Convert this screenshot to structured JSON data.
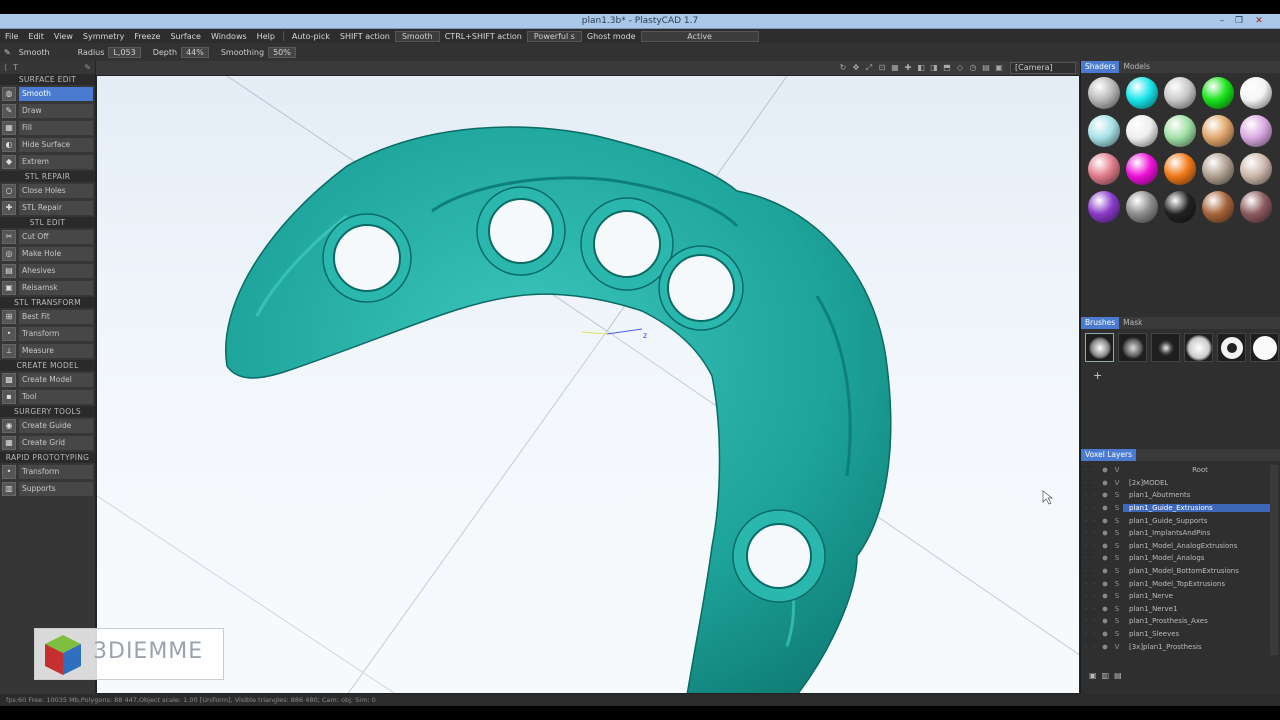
{
  "window": {
    "title": "plan1.3b* - PlastyCAD 1.7",
    "minimize": "–",
    "maximize": "❐",
    "close": "✕"
  },
  "menubar": {
    "items": [
      "File",
      "Edit",
      "View",
      "Symmetry",
      "Freeze",
      "Surface",
      "Windows",
      "Help"
    ],
    "auto_pick": "Auto-pick",
    "shift_action_label": "SHIFT action",
    "shift_action_value": "Smooth",
    "ctrl_shift_label": "CTRL+SHIFT action",
    "ctrl_shift_value": "Powerful s",
    "ghost_label": "Ghost mode",
    "ghost_value": "Active"
  },
  "toolbar": {
    "tool_name": "Smooth",
    "radius_label": "Radius",
    "radius_value": "L,053",
    "depth_label": "Depth",
    "depth_value": "44%",
    "smoothing_label": "Smoothing",
    "smoothing_value": "50%"
  },
  "viewbar": {
    "camera": "[Camera]"
  },
  "left_panel": {
    "sections": [
      {
        "title": "SURFACE EDIT",
        "tools": [
          {
            "label": "Smooth",
            "active": true,
            "icon": "◍"
          },
          {
            "label": "Draw",
            "icon": "✎"
          },
          {
            "label": "Fill",
            "icon": "▦"
          },
          {
            "label": "Hide Surface",
            "icon": "◐"
          },
          {
            "label": "Extrem",
            "icon": "◆"
          }
        ]
      },
      {
        "title": "STL REPAIR",
        "tools": [
          {
            "label": "Close Holes",
            "icon": "○"
          },
          {
            "label": "STL Repair",
            "icon": "✚"
          }
        ]
      },
      {
        "title": "STL EDIT",
        "tools": [
          {
            "label": "Cut Off",
            "icon": "✂"
          },
          {
            "label": "Make Hole",
            "icon": "◎"
          },
          {
            "label": "Ahesives",
            "icon": "▤"
          },
          {
            "label": "Reisamsk",
            "icon": "▣"
          }
        ]
      },
      {
        "title": "STL TRANSFORM",
        "tools": [
          {
            "label": "Best Fit",
            "icon": "⊞"
          },
          {
            "label": "Transform",
            "icon": "•"
          },
          {
            "label": "Measure",
            "icon": "⟂"
          }
        ]
      },
      {
        "title": "CREATE MODEL",
        "tools": [
          {
            "label": "Create Model",
            "icon": "▩"
          },
          {
            "label": "Tool",
            "icon": "▪"
          }
        ]
      },
      {
        "title": "SURGERY TOOLS",
        "tools": [
          {
            "label": "Create Guide",
            "icon": "◉"
          },
          {
            "label": "Create Grid",
            "icon": "▦"
          }
        ]
      },
      {
        "title": "RAPID PROTOTYPING",
        "tools": [
          {
            "label": "Transform",
            "icon": "•"
          },
          {
            "label": "Supports",
            "icon": "▥"
          }
        ]
      }
    ]
  },
  "right_panel": {
    "shaders_tab": "Shaders",
    "models_tab": "Models",
    "brushes_tab": "Brushes",
    "mask_tab": "Mask",
    "layers_tab": "Voxel Layers",
    "add_brush": "+",
    "shader_colors": [
      "#b8b8b8",
      "#17e5ea",
      "#c9c9c9",
      "#17e31a",
      "#f4f4f4",
      "#a5e1e6",
      "#eeeeee",
      "#9fe0a4",
      "#e0a66a",
      "#d9a8e2",
      "#e07b8a",
      "#ee11d8",
      "#f07818",
      "#b0a090",
      "#cdb7ab",
      "#8a3acb",
      "#8c8c8c",
      "#222222",
      "#a7643a",
      "#8c5a60"
    ],
    "layers": [
      {
        "flag": "V",
        "name": "Root",
        "root": true
      },
      {
        "flag": "V",
        "name": "[2x]MODEL"
      },
      {
        "flag": "S",
        "name": "plan1_Abutments"
      },
      {
        "flag": "S",
        "name": "plan1_Guide_Extrusions",
        "active": true
      },
      {
        "flag": "S",
        "name": "plan1_Guide_Supports"
      },
      {
        "flag": "S",
        "name": "plan1_ImplantsAndPins"
      },
      {
        "flag": "S",
        "name": "plan1_Model_AnalogExtrusions"
      },
      {
        "flag": "S",
        "name": "plan1_Model_Analogs"
      },
      {
        "flag": "S",
        "name": "plan1_Model_BottomExtrusions"
      },
      {
        "flag": "S",
        "name": "plan1_Model_TopExtrusions"
      },
      {
        "flag": "S",
        "name": "plan1_Nerve"
      },
      {
        "flag": "S",
        "name": "plan1_Nerve1"
      },
      {
        "flag": "S",
        "name": "plan1_Prosthesis_Axes"
      },
      {
        "flag": "S",
        "name": "plan1_Sleeves"
      },
      {
        "flag": "V",
        "name": "[3x]plan1_Prosthesis"
      }
    ]
  },
  "watermark": {
    "brand": "3DIEMME"
  },
  "statusbar": {
    "text": "fps:60   Free: 10035 Mb,Polygons: 88 447,Object scale: 1.00 [Uniform], Visible triangles: 886 480; Cam: obj; Sim: 0"
  },
  "colors": {
    "model": "#1fa39a",
    "accent": "#4a7bd0"
  }
}
